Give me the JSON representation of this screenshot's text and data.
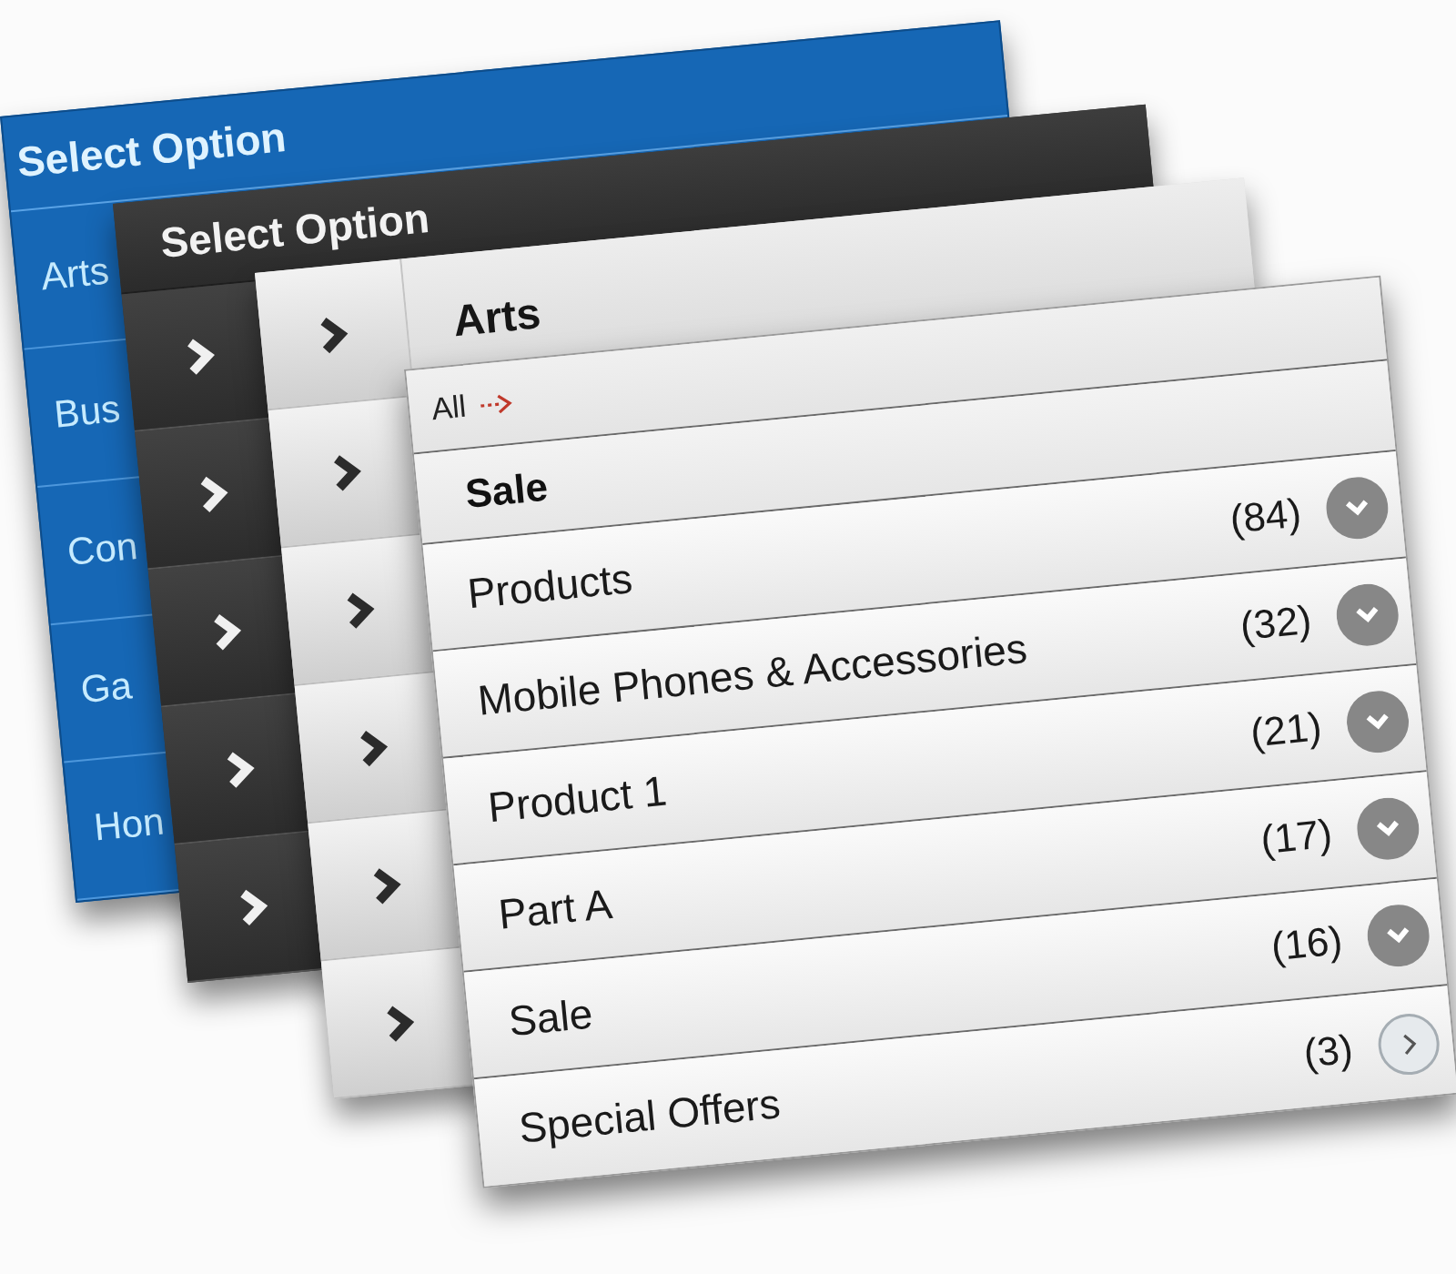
{
  "blue_menu": {
    "title": "Select Option",
    "items": [
      "Arts",
      "Bus",
      "Con",
      "Ga",
      "Hon"
    ]
  },
  "dark_menu": {
    "title": "Select Option",
    "items": [
      {
        "kind": "submenu"
      },
      {
        "kind": "submenu"
      },
      {
        "kind": "submenu"
      },
      {
        "kind": "submenu"
      },
      {
        "kind": "submenu"
      }
    ]
  },
  "category_menu": {
    "title": "Arts",
    "items": [
      {
        "kind": "submenu"
      },
      {
        "kind": "submenu"
      },
      {
        "kind": "submenu"
      },
      {
        "kind": "submenu"
      },
      {
        "kind": "submenu"
      }
    ]
  },
  "subcategory_menu": {
    "back_link": "All",
    "section": "Sale",
    "items": [
      {
        "label": "Products",
        "count": "(84)",
        "kind": "expandable"
      },
      {
        "label": "Mobile Phones & Accessories",
        "count": "(32)",
        "kind": "expandable"
      },
      {
        "label": "Product 1",
        "count": "(21)",
        "kind": "expandable"
      },
      {
        "label": "Part A",
        "count": "(17)",
        "kind": "expandable"
      },
      {
        "label": "Sale",
        "count": "(16)",
        "kind": "expandable"
      },
      {
        "label": "Special Offers",
        "count": "(3)",
        "kind": "link"
      }
    ]
  }
}
